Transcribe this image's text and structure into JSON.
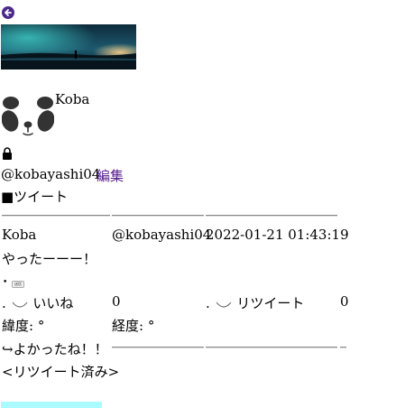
{
  "profile": {
    "display_name": "Koba",
    "handle": "@kobayashi04",
    "edit_label": "編集",
    "section_title": "■ツイート"
  },
  "tweet": {
    "author_name": "Koba",
    "author_handle": "@kobayashi04",
    "timestamp": "2022-01-21 01:43:19",
    "body": "やったーーー！",
    "button_label": "送信",
    "like_label": "いいね",
    "like_count": "0",
    "retweet_label": "リツイート",
    "retweet_count": "0",
    "latitude_label": "緯度: °",
    "longitude_label": "経度: °",
    "reply_text": "↪よかったね！！",
    "retweeted_label": "<リツイート済み>"
  },
  "icons": {
    "back": "arrow-left-circle-icon",
    "lock": "lock-icon",
    "avatar": "panda-icon"
  },
  "colors": {
    "link": "#551a8b",
    "back_button": "#4b2a8a",
    "accent_bar": "#aafaff"
  }
}
